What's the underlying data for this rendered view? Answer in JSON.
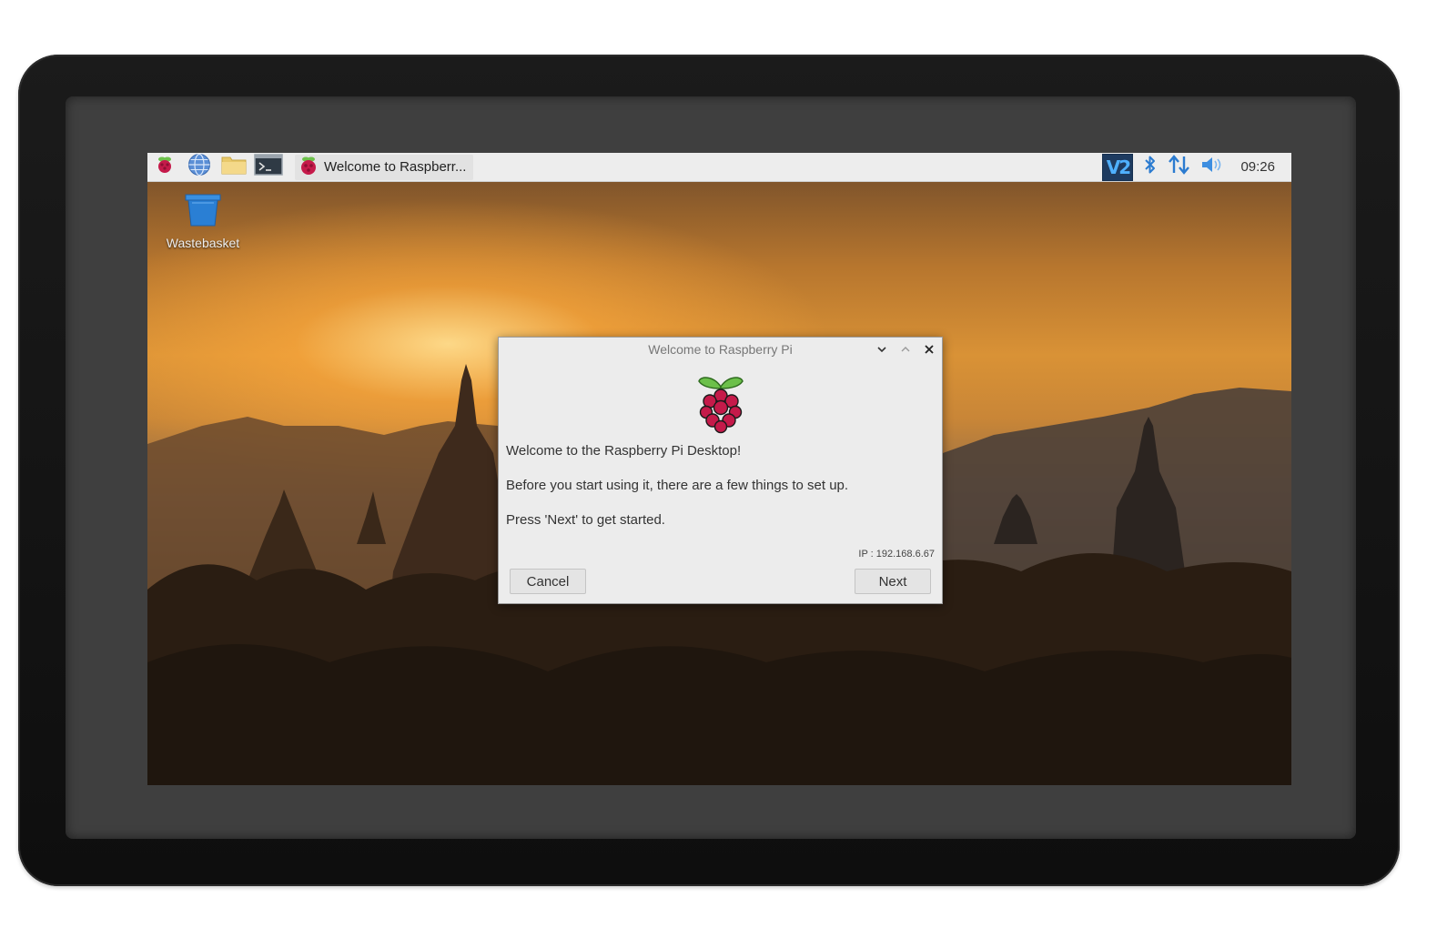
{
  "taskbar": {
    "task_title": "Welcome to Raspberr...",
    "clock": "09:26",
    "vnc_label": "V2"
  },
  "desktop": {
    "icons": [
      {
        "label": "Wastebasket",
        "icon": "wastebasket-icon"
      }
    ]
  },
  "dialog": {
    "title": "Welcome to Raspberry Pi",
    "heading": "Welcome to the Raspberry Pi Desktop!",
    "body": "Before you start using it, there are a few things to set up.",
    "hint": "Press 'Next' to get started.",
    "ip": "IP : 192.168.6.67",
    "cancel_label": "Cancel",
    "next_label": "Next"
  },
  "colors": {
    "taskbar_bg": "#ededed",
    "dialog_bg": "#ececec",
    "raspberry_red": "#c51a4a",
    "leaf_green": "#6cc04a",
    "vnc_blue": "#1e3b60"
  }
}
